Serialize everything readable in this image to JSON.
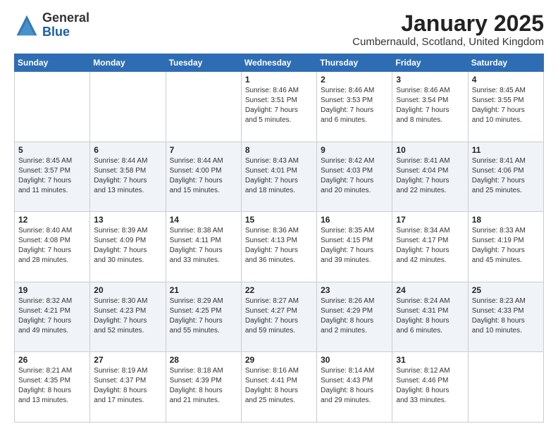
{
  "header": {
    "logo_general": "General",
    "logo_blue": "Blue",
    "month_title": "January 2025",
    "location": "Cumbernauld, Scotland, United Kingdom"
  },
  "days_of_week": [
    "Sunday",
    "Monday",
    "Tuesday",
    "Wednesday",
    "Thursday",
    "Friday",
    "Saturday"
  ],
  "weeks": [
    [
      {
        "day": "",
        "info": ""
      },
      {
        "day": "",
        "info": ""
      },
      {
        "day": "",
        "info": ""
      },
      {
        "day": "1",
        "info": "Sunrise: 8:46 AM\nSunset: 3:51 PM\nDaylight: 7 hours\nand 5 minutes."
      },
      {
        "day": "2",
        "info": "Sunrise: 8:46 AM\nSunset: 3:53 PM\nDaylight: 7 hours\nand 6 minutes."
      },
      {
        "day": "3",
        "info": "Sunrise: 8:46 AM\nSunset: 3:54 PM\nDaylight: 7 hours\nand 8 minutes."
      },
      {
        "day": "4",
        "info": "Sunrise: 8:45 AM\nSunset: 3:55 PM\nDaylight: 7 hours\nand 10 minutes."
      }
    ],
    [
      {
        "day": "5",
        "info": "Sunrise: 8:45 AM\nSunset: 3:57 PM\nDaylight: 7 hours\nand 11 minutes."
      },
      {
        "day": "6",
        "info": "Sunrise: 8:44 AM\nSunset: 3:58 PM\nDaylight: 7 hours\nand 13 minutes."
      },
      {
        "day": "7",
        "info": "Sunrise: 8:44 AM\nSunset: 4:00 PM\nDaylight: 7 hours\nand 15 minutes."
      },
      {
        "day": "8",
        "info": "Sunrise: 8:43 AM\nSunset: 4:01 PM\nDaylight: 7 hours\nand 18 minutes."
      },
      {
        "day": "9",
        "info": "Sunrise: 8:42 AM\nSunset: 4:03 PM\nDaylight: 7 hours\nand 20 minutes."
      },
      {
        "day": "10",
        "info": "Sunrise: 8:41 AM\nSunset: 4:04 PM\nDaylight: 7 hours\nand 22 minutes."
      },
      {
        "day": "11",
        "info": "Sunrise: 8:41 AM\nSunset: 4:06 PM\nDaylight: 7 hours\nand 25 minutes."
      }
    ],
    [
      {
        "day": "12",
        "info": "Sunrise: 8:40 AM\nSunset: 4:08 PM\nDaylight: 7 hours\nand 28 minutes."
      },
      {
        "day": "13",
        "info": "Sunrise: 8:39 AM\nSunset: 4:09 PM\nDaylight: 7 hours\nand 30 minutes."
      },
      {
        "day": "14",
        "info": "Sunrise: 8:38 AM\nSunset: 4:11 PM\nDaylight: 7 hours\nand 33 minutes."
      },
      {
        "day": "15",
        "info": "Sunrise: 8:36 AM\nSunset: 4:13 PM\nDaylight: 7 hours\nand 36 minutes."
      },
      {
        "day": "16",
        "info": "Sunrise: 8:35 AM\nSunset: 4:15 PM\nDaylight: 7 hours\nand 39 minutes."
      },
      {
        "day": "17",
        "info": "Sunrise: 8:34 AM\nSunset: 4:17 PM\nDaylight: 7 hours\nand 42 minutes."
      },
      {
        "day": "18",
        "info": "Sunrise: 8:33 AM\nSunset: 4:19 PM\nDaylight: 7 hours\nand 45 minutes."
      }
    ],
    [
      {
        "day": "19",
        "info": "Sunrise: 8:32 AM\nSunset: 4:21 PM\nDaylight: 7 hours\nand 49 minutes."
      },
      {
        "day": "20",
        "info": "Sunrise: 8:30 AM\nSunset: 4:23 PM\nDaylight: 7 hours\nand 52 minutes."
      },
      {
        "day": "21",
        "info": "Sunrise: 8:29 AM\nSunset: 4:25 PM\nDaylight: 7 hours\nand 55 minutes."
      },
      {
        "day": "22",
        "info": "Sunrise: 8:27 AM\nSunset: 4:27 PM\nDaylight: 7 hours\nand 59 minutes."
      },
      {
        "day": "23",
        "info": "Sunrise: 8:26 AM\nSunset: 4:29 PM\nDaylight: 8 hours\nand 2 minutes."
      },
      {
        "day": "24",
        "info": "Sunrise: 8:24 AM\nSunset: 4:31 PM\nDaylight: 8 hours\nand 6 minutes."
      },
      {
        "day": "25",
        "info": "Sunrise: 8:23 AM\nSunset: 4:33 PM\nDaylight: 8 hours\nand 10 minutes."
      }
    ],
    [
      {
        "day": "26",
        "info": "Sunrise: 8:21 AM\nSunset: 4:35 PM\nDaylight: 8 hours\nand 13 minutes."
      },
      {
        "day": "27",
        "info": "Sunrise: 8:19 AM\nSunset: 4:37 PM\nDaylight: 8 hours\nand 17 minutes."
      },
      {
        "day": "28",
        "info": "Sunrise: 8:18 AM\nSunset: 4:39 PM\nDaylight: 8 hours\nand 21 minutes."
      },
      {
        "day": "29",
        "info": "Sunrise: 8:16 AM\nSunset: 4:41 PM\nDaylight: 8 hours\nand 25 minutes."
      },
      {
        "day": "30",
        "info": "Sunrise: 8:14 AM\nSunset: 4:43 PM\nDaylight: 8 hours\nand 29 minutes."
      },
      {
        "day": "31",
        "info": "Sunrise: 8:12 AM\nSunset: 4:46 PM\nDaylight: 8 hours\nand 33 minutes."
      },
      {
        "day": "",
        "info": ""
      }
    ]
  ]
}
